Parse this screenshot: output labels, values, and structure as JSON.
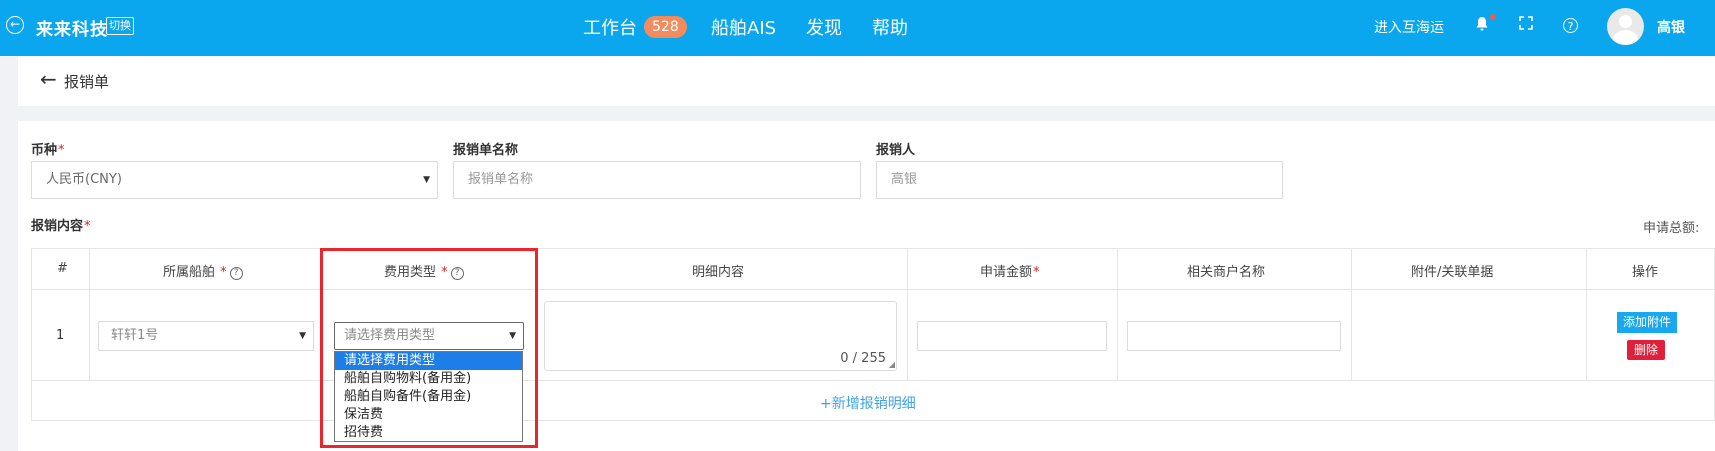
{
  "header": {
    "logo": "来来科技",
    "switch_label": "切换",
    "nav": [
      {
        "label": "工作台",
        "badge": "528"
      },
      {
        "label": "船舶AIS"
      },
      {
        "label": "发现"
      },
      {
        "label": "帮助"
      }
    ],
    "enter_link": "进入互海运",
    "user_name": "高银",
    "icons": [
      "back-circle-icon",
      "bell-icon",
      "fullscreen-icon",
      "help-icon",
      "avatar"
    ]
  },
  "page": {
    "title": "报销单"
  },
  "form": {
    "currency": {
      "label": "币种",
      "value": "人民币(CNY)"
    },
    "name": {
      "label": "报销单名称",
      "placeholder": "报销单名称"
    },
    "person": {
      "label": "报销人",
      "value": "高银"
    },
    "content_label": "报销内容",
    "total_label": "申请总额:"
  },
  "table": {
    "columns": [
      "#",
      "所属船舶",
      "费用类型",
      "明细内容",
      "申请金额",
      "相关商户名称",
      "附件/关联单据",
      "操作"
    ],
    "row": {
      "index": "1",
      "ship": "轩轩1号",
      "fee_placeholder": "请选择费用类型",
      "counter": "0 / 255",
      "attach_button": "添加附件",
      "delete_button": "删除"
    },
    "add_detail": "+新增报销明细"
  },
  "dropdown": {
    "options": [
      "请选择费用类型",
      "船舶自购物料(备用金)",
      "船舶自购备件(备用金)",
      "保洁费",
      "招待费"
    ],
    "selected_index": 0
  },
  "colors": {
    "header_bg": "#0aa6ee",
    "accent": "#19a8f0",
    "danger": "#e0203a",
    "highlight": "#e8262b",
    "required": "#e02020"
  }
}
